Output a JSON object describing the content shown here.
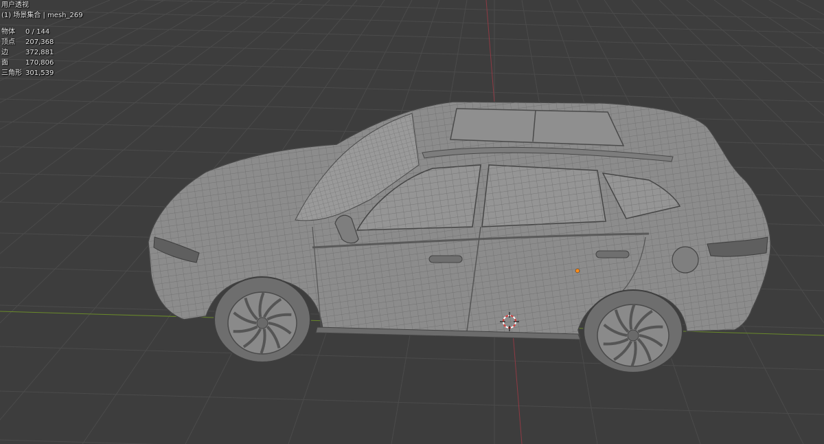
{
  "viewport": {
    "view_name": "用户透视",
    "collection_info": "(1) 场景集合 | mesh_269",
    "stats": [
      {
        "label": "物体",
        "value": "0 / 144"
      },
      {
        "label": "顶点",
        "value": "207,368"
      },
      {
        "label": "边",
        "value": "372,881"
      },
      {
        "label": "面",
        "value": "170,806"
      },
      {
        "label": "三角形",
        "value": "301,539"
      }
    ]
  },
  "colors": {
    "background": "#3d3d3d",
    "grid": "#4b4b4b",
    "x_axis": "#8f3a44",
    "y_axis": "#6a8a2a",
    "mesh_fill": "#8c8c8c",
    "wire": "#5e5e5e",
    "edge": "#444444",
    "origin_dot": "#ff8c1a",
    "cursor_red": "#d83c3c",
    "cursor_white": "#ffffff"
  },
  "icons": {
    "cursor": "3d-cursor-icon",
    "origin": "object-origin-dot"
  }
}
